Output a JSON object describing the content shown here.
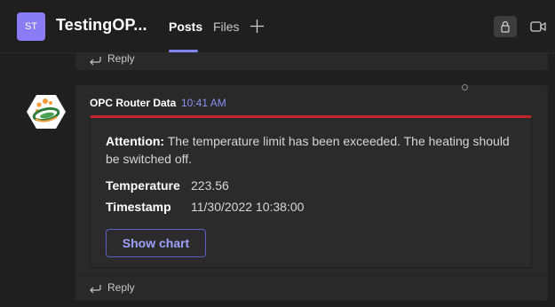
{
  "header": {
    "avatar_initials": "ST",
    "team_name": "TestingOP...",
    "tabs": [
      {
        "label": "Posts",
        "active": true
      },
      {
        "label": "Files",
        "active": false
      }
    ]
  },
  "thread": {
    "previous_reply_label": "Reply",
    "message": {
      "sender": "OPC Router Data",
      "time": "10:41 AM",
      "card": {
        "accent_color": "#c4242b",
        "attention_prefix": "Attention:",
        "attention_text": " The temperature limit has been exceeded. The heating should be switched off.",
        "facts": [
          {
            "label": "Temperature",
            "value": "223.56"
          },
          {
            "label": "Timestamp",
            "value": "11/30/2022 10:38:00"
          }
        ],
        "action_label": "Show chart"
      },
      "reply_label": "Reply"
    }
  },
  "colors": {
    "brand": "#7f85f5",
    "background": "#1f1f1f"
  }
}
